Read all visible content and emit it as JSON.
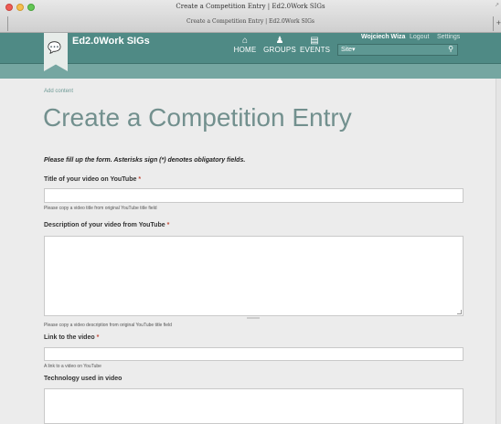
{
  "window": {
    "title": "Create a Competition Entry | Ed2.0Work SIGs",
    "tab_title": "Create a Competition Entry | Ed2.0Work SIGs"
  },
  "header": {
    "site_name": "Ed2.0Work SIGs",
    "nav": [
      {
        "label": "HOME",
        "icon": "home-icon"
      },
      {
        "label": "GROUPS",
        "icon": "groups-icon"
      },
      {
        "label": "EVENTS",
        "icon": "calendar-icon"
      }
    ],
    "user_name": "Wojciech Wiza",
    "logout": "Logout",
    "settings": "Settings",
    "search_scope": "Site▾",
    "search_placeholder": ""
  },
  "content": {
    "breadcrumb": "Add content",
    "page_title": "Create a Competition Entry",
    "intro": "Please fill up the form. Asterisks sign (*) denotes obligatory fields.",
    "fields": [
      {
        "label": "Title of your video on YouTube",
        "required": true,
        "value": "",
        "help": "Please copy a video title from original YouTube title field"
      },
      {
        "label": "Description of your video from YouTube",
        "required": true,
        "value": "",
        "help": "Please copy a video description from original YouTube title field"
      },
      {
        "label": "Link to the video",
        "required": true,
        "value": "",
        "help": "A link to a video on YouTube"
      },
      {
        "label": "Technology used in video",
        "required": false,
        "value": "",
        "help": ""
      }
    ],
    "required_mark": "*"
  },
  "colors": {
    "header_bg": "#4f8a85",
    "header_band": "#75a6a1",
    "title_color": "#72908e",
    "required_color": "#c24a3a"
  }
}
